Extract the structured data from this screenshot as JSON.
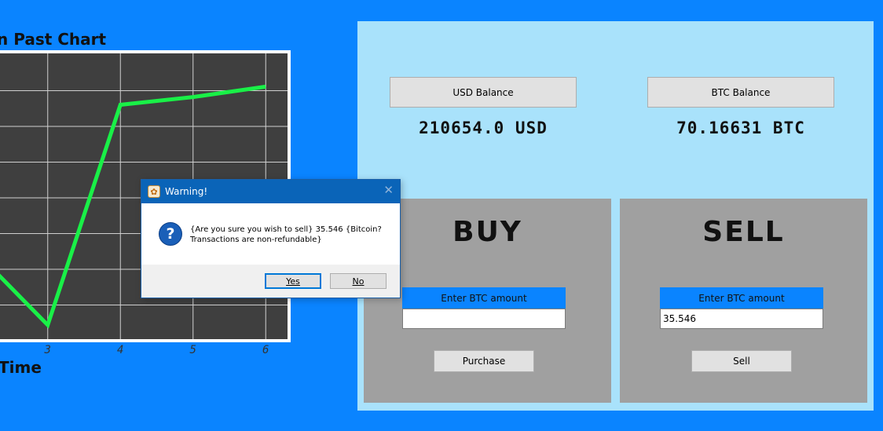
{
  "chart": {
    "title": "n Past Chart",
    "xlabel": "Time"
  },
  "chart_data": {
    "type": "line",
    "title": "n Past Chart",
    "xlabel": "Time",
    "ylabel": "",
    "xlim": [
      2.3,
      6.3
    ],
    "x_ticks": [
      3,
      4,
      5,
      6
    ],
    "x_tick_labels": [
      "3",
      "4",
      "5",
      "6"
    ],
    "grid": true,
    "series": [
      {
        "x": [
          2.3,
          3,
          4,
          5,
          6
        ],
        "y": [
          0.2,
          0.0,
          0.85,
          0.88,
          0.92
        ],
        "color": "#19f047"
      }
    ],
    "ylim_relative": [
      0,
      1
    ]
  },
  "colors": {
    "background": "#0a84ff",
    "panel": "#a9e2fb",
    "trade_box": "#a0a0a0",
    "plot_bg": "#3f3f3f",
    "grid": "#d0d0d0",
    "line": "#19f047",
    "dialog_title": "#0a64b8"
  },
  "balances": {
    "usd_label": "USD Balance",
    "usd_value": "210654.0 USD",
    "btc_label": "BTC Balance",
    "btc_value": "70.16631 BTC"
  },
  "buy": {
    "heading": "BUY",
    "amount_label": "Enter BTC amount",
    "amount_value": "",
    "button": "Purchase"
  },
  "sell": {
    "heading": "SELL",
    "amount_label": "Enter BTC amount",
    "amount_value": "35.546",
    "button": "Sell"
  },
  "dialog": {
    "title": "Warning!",
    "close": "✕",
    "icon": "question-icon",
    "message": "{Are you sure you wish to sell} 35.546 {Bitcoin? Transactions are non-refundable}",
    "yes_label": "Yes",
    "no_label": "No"
  }
}
